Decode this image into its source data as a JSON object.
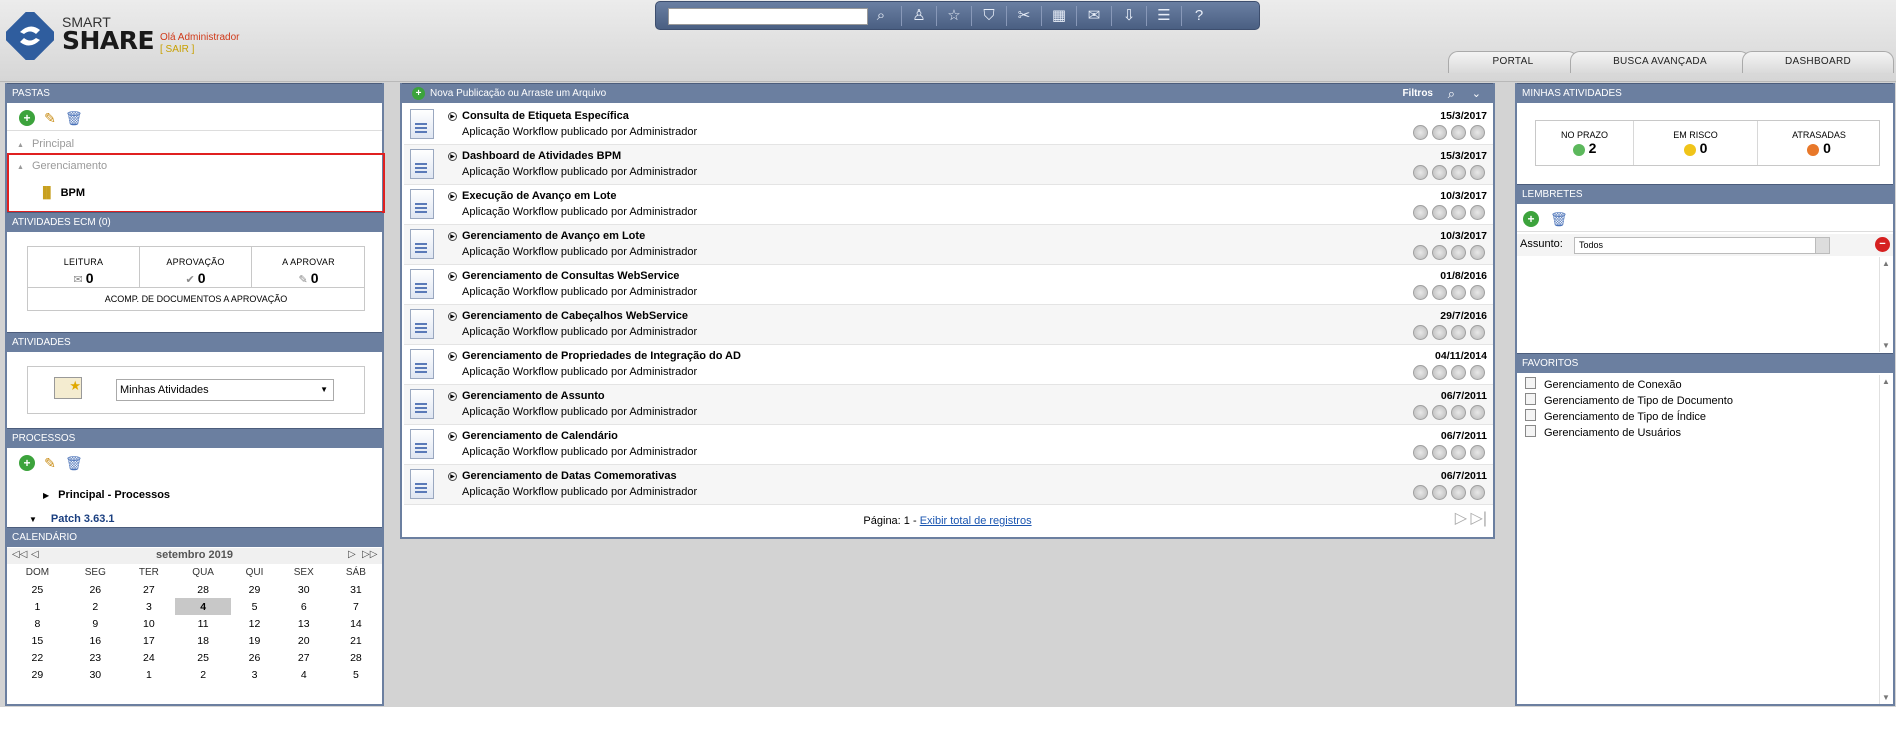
{
  "header": {
    "logo_smart": "SMART",
    "logo_share": "SHARE",
    "greeting": "Olá Administrador",
    "logout": "[ SAIR ]",
    "search_placeholder": "",
    "tabs": [
      "PORTAL",
      "BUSCA AVANÇADA",
      "DASHBOARD"
    ]
  },
  "toolbar": {
    "icons": [
      "search-icon",
      "user-icon",
      "star-icon",
      "filter-icon",
      "tools-icon",
      "calendar-icon",
      "mail-icon",
      "download-icon",
      "list-icon",
      "help-icon"
    ]
  },
  "pastas": {
    "title": "PASTAS",
    "principal": "Principal",
    "gerenciamento": "Gerenciamento",
    "bpm": "BPM"
  },
  "ecm": {
    "title": "ATIVIDADES ECM (0)",
    "cols": [
      {
        "label": "LEITURA",
        "value": "0"
      },
      {
        "label": "APROVAÇÃO",
        "value": "0"
      },
      {
        "label": "A APROVAR",
        "value": "0"
      }
    ],
    "footer": "ACOMP. DE DOCUMENTOS A APROVAÇÃO"
  },
  "atividades": {
    "title": "ATIVIDADES",
    "select_value": "Minhas Atividades"
  },
  "processos": {
    "title": "PROCESSOS",
    "items": [
      "Principal - Processos",
      "Patch 3.63.1"
    ]
  },
  "calendario": {
    "title": "CALENDÁRIO",
    "month": "setembro 2019",
    "weekdays": [
      "DOM",
      "SEG",
      "TER",
      "QUA",
      "QUI",
      "SEX",
      "SÁB"
    ],
    "weeks": [
      [
        "25",
        "26",
        "27",
        "28",
        "29",
        "30",
        "31"
      ],
      [
        "1",
        "2",
        "3",
        "4",
        "5",
        "6",
        "7"
      ],
      [
        "8",
        "9",
        "10",
        "11",
        "12",
        "13",
        "14"
      ],
      [
        "15",
        "16",
        "17",
        "18",
        "19",
        "20",
        "21"
      ],
      [
        "22",
        "23",
        "24",
        "25",
        "26",
        "27",
        "28"
      ],
      [
        "29",
        "30",
        "1",
        "2",
        "3",
        "4",
        "5"
      ]
    ],
    "today": "4"
  },
  "publicacoes": {
    "header": "Nova Publicação ou Arraste um Arquivo",
    "filtros": "Filtros",
    "items": [
      {
        "title": "Consulta de Etiqueta Específica",
        "sub": "Aplicação Workflow publicado por Administrador",
        "date": "15/3/2017"
      },
      {
        "title": "Dashboard de Atividades BPM",
        "sub": "Aplicação Workflow publicado por Administrador",
        "date": "15/3/2017"
      },
      {
        "title": "Execução de Avanço em Lote",
        "sub": "Aplicação Workflow publicado por Administrador",
        "date": "10/3/2017"
      },
      {
        "title": "Gerenciamento de Avanço em Lote",
        "sub": "Aplicação Workflow publicado por Administrador",
        "date": "10/3/2017"
      },
      {
        "title": "Gerenciamento de Consultas WebService",
        "sub": "Aplicação Workflow publicado por Administrador",
        "date": "01/8/2016"
      },
      {
        "title": "Gerenciamento de Cabeçalhos WebService",
        "sub": "Aplicação Workflow publicado por Administrador",
        "date": "29/7/2016"
      },
      {
        "title": "Gerenciamento de Propriedades de Integração do AD",
        "sub": "Aplicação Workflow publicado por Administrador",
        "date": "04/11/2014"
      },
      {
        "title": "Gerenciamento de Assunto",
        "sub": "Aplicação Workflow publicado por Administrador",
        "date": "06/7/2011"
      },
      {
        "title": "Gerenciamento de Calendário",
        "sub": "Aplicação Workflow publicado por Administrador",
        "date": "06/7/2011"
      },
      {
        "title": "Gerenciamento de Datas Comemorativas",
        "sub": "Aplicação Workflow publicado por Administrador",
        "date": "06/7/2011"
      }
    ],
    "pagination_label": "Página: 1 -",
    "pagination_link": "Exibir total de registros"
  },
  "minhas_atividades": {
    "title": "MINHAS ATIVIDADES",
    "stats": [
      {
        "label": "NO PRAZO",
        "value": "2",
        "color": "#5cb85c"
      },
      {
        "label": "EM RISCO",
        "value": "0",
        "color": "#f0c419"
      },
      {
        "label": "ATRASADAS",
        "value": "0",
        "color": "#e8782a"
      }
    ]
  },
  "lembretes": {
    "title": "LEMBRETES",
    "assunto_label": "Assunto:",
    "assunto_value": "Todos"
  },
  "favoritos": {
    "title": "FAVORITOS",
    "items": [
      "Gerenciamento de Conexão",
      "Gerenciamento de Tipo de Documento",
      "Gerenciamento de Tipo de Índice",
      "Gerenciamento de Usuários"
    ]
  },
  "colors": {
    "panel_header": "#6b7fa0",
    "highlight_border": "#e02020"
  }
}
